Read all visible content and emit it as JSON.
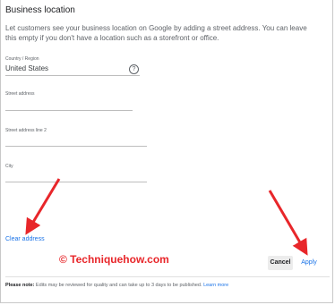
{
  "panel": {
    "title": "Business location",
    "description": "Let customers see your business location on Google by adding a street address. You can leave this empty if you don't have a location such as a storefront or office."
  },
  "fields": {
    "country": {
      "label": "Country / Region",
      "value": "United States",
      "help_icon": "?"
    },
    "street": {
      "label": "Street address",
      "value": ""
    },
    "street2": {
      "label": "Street address line 2",
      "value": ""
    },
    "city": {
      "label": "City",
      "value": ""
    }
  },
  "actions": {
    "clear_label": "Clear address",
    "cancel_label": "Cancel",
    "apply_label": "Apply"
  },
  "watermark": "© Techniquehow.com",
  "footer": {
    "note_bold": "Please note:",
    "note_text": " Edits may be reviewed for quality and can take up to 3 days to be published. ",
    "learn_more": "Learn more"
  },
  "colors": {
    "link": "#1a73e8",
    "arrow": "#e8262a"
  }
}
